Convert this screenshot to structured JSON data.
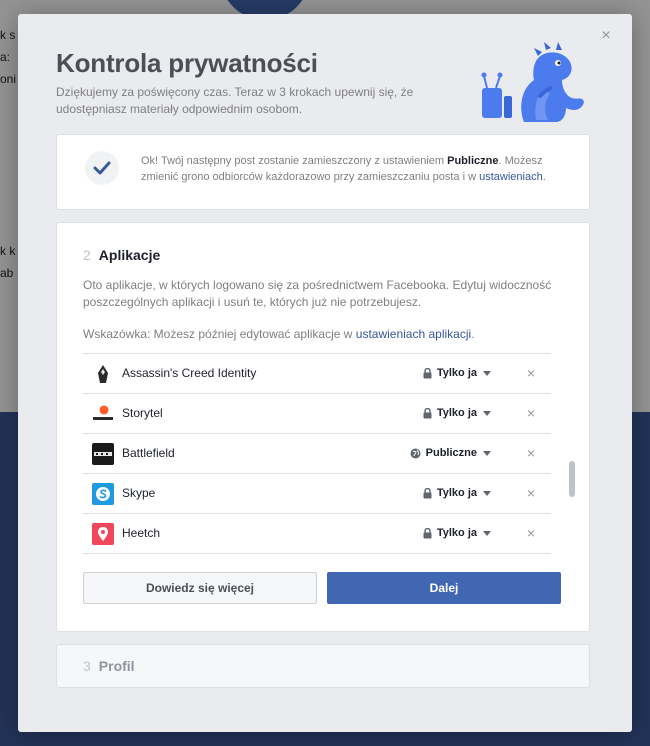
{
  "background": {
    "fragments": [
      "k s",
      "a:",
      "oni",
      "k k",
      "ab"
    ]
  },
  "modal": {
    "close_label": "×",
    "title": "Kontrola prywatności",
    "subtitle": "Dziękujemy za poświęcony czas. Teraz w 3 krokach upewnij się, że udostępniasz materiały odpowiednim osobom."
  },
  "confirm": {
    "text_before": "Ok! Twój następny post zostanie zamieszczony z ustawieniem ",
    "setting": "Publiczne",
    "text_middle": ". Możesz zmienić grono odbiorców każdorazowo przy zamieszczaniu posta i w ",
    "link": "ustawieniach",
    "text_after": "."
  },
  "apps_step": {
    "number": "2",
    "name": "Aplikacje",
    "description": "Oto aplikacje, w których logowano się za pośrednictwem Facebooka. Edytuj widoczność poszczególnych aplikacji i usuń te, których już nie potrzebujesz.",
    "tip_before": "Wskazówka: Możesz później edytować aplikacje w ",
    "tip_link": "ustawieniach aplikacji",
    "tip_after": ".",
    "apps": [
      {
        "name": "Assassin's Creed Identity",
        "audience": "Tylko ja",
        "audience_icon": "lock-icon",
        "icon": "assassins-creed-icon"
      },
      {
        "name": "Storytel",
        "audience": "Tylko ja",
        "audience_icon": "lock-icon",
        "icon": "storytel-icon"
      },
      {
        "name": "Battlefield",
        "audience": "Publiczne",
        "audience_icon": "globe-icon",
        "icon": "battlefield-icon"
      },
      {
        "name": "Skype",
        "audience": "Tylko ja",
        "audience_icon": "lock-icon",
        "icon": "skype-icon"
      },
      {
        "name": "Heetch",
        "audience": "Tylko ja",
        "audience_icon": "lock-icon",
        "icon": "heetch-icon"
      }
    ],
    "remove_label": "×",
    "learn_more_label": "Dowiedz się więcej",
    "next_label": "Dalej"
  },
  "profile_step": {
    "number": "3",
    "name": "Profil"
  },
  "colors": {
    "accent": "#4267b2",
    "link": "#365899",
    "dino": "#4b7bec",
    "check": "#3b5998"
  }
}
